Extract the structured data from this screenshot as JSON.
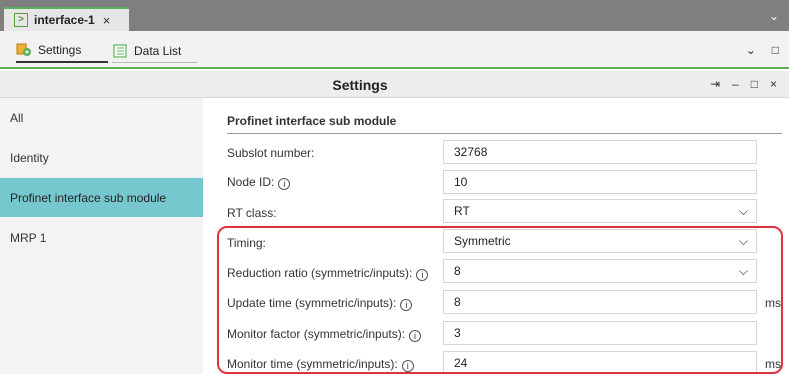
{
  "tab": {
    "title": "interface-1",
    "close": "×",
    "icon": "console-icon"
  },
  "tabbar": {
    "overflow": "⌄"
  },
  "toolbar": {
    "views": [
      {
        "label": "Settings",
        "icon": "settings-icon"
      },
      {
        "label": "Data List",
        "icon": "list-icon"
      }
    ],
    "chevron": "⌄",
    "maximize": "□"
  },
  "panel": {
    "title": "Settings",
    "pin": "⇥",
    "minimize": "–",
    "restore": "□",
    "close": "×"
  },
  "nav": {
    "items": [
      {
        "label": "All"
      },
      {
        "label": "Identity"
      },
      {
        "label": "Profinet interface sub module",
        "active": true
      },
      {
        "label": "MRP 1"
      }
    ]
  },
  "main": {
    "section_title": "Profinet interface sub module",
    "rows": [
      {
        "label": "Subslot number:",
        "info": false,
        "value": "32768",
        "type": "text",
        "unit": ""
      },
      {
        "label": "Node ID:",
        "info": true,
        "value": "10",
        "type": "text",
        "unit": ""
      },
      {
        "label": "RT class:",
        "info": false,
        "value": "RT",
        "type": "select",
        "unit": ""
      },
      {
        "label": "Timing:",
        "info": false,
        "value": "Symmetric",
        "type": "select",
        "unit": ""
      },
      {
        "label": "Reduction ratio (symmetric/inputs):",
        "info": true,
        "value": "8",
        "type": "select",
        "unit": ""
      },
      {
        "label": "Update time (symmetric/inputs):",
        "info": true,
        "value": "8",
        "type": "text",
        "unit": "ms"
      },
      {
        "label": "Monitor factor (symmetric/inputs):",
        "info": true,
        "value": "3",
        "type": "text",
        "unit": ""
      },
      {
        "label": "Monitor time (symmetric/inputs):",
        "info": true,
        "value": "24",
        "type": "text",
        "unit": "ms"
      }
    ]
  },
  "colors": {
    "accent": "#5bb25b",
    "nav_active": "#77c7cf",
    "highlight": "#e0323a"
  }
}
